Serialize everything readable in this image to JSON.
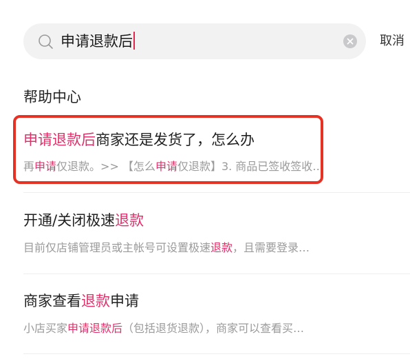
{
  "search": {
    "query": "申请退款后",
    "cancel_label": "取消"
  },
  "section": {
    "title": "帮助中心"
  },
  "results": [
    {
      "title_hl": "申请退款后",
      "title_rest": "商家还是发货了，怎么办",
      "snippet": [
        {
          "t": "再",
          "hl": false
        },
        {
          "t": "申请",
          "hl": true
        },
        {
          "t": "仅退款。>> 【怎么",
          "hl": false
        },
        {
          "t": "申请",
          "hl": true
        },
        {
          "t": "仅退款】3. 商品已签收签收…",
          "hl": false
        }
      ]
    },
    {
      "title_pre": "开通/关闭极速",
      "title_hl": "退款",
      "snippet": [
        {
          "t": "目前仅店铺管理员或主帐号可设置极速",
          "hl": false
        },
        {
          "t": "退款",
          "hl": true
        },
        {
          "t": "，且需要登录…",
          "hl": false
        }
      ]
    },
    {
      "title_pre": "商家查看",
      "title_hl": "退款",
      "title_post": "申请",
      "snippet": [
        {
          "t": "小店买家",
          "hl": false
        },
        {
          "t": "申请退款后",
          "hl": true
        },
        {
          "t": "（包括退货退款），商家可以查看买…",
          "hl": false
        }
      ]
    }
  ],
  "colors": {
    "highlight": "#e0306a",
    "annotation_box": "#e53224",
    "caret": "#e0264a"
  }
}
